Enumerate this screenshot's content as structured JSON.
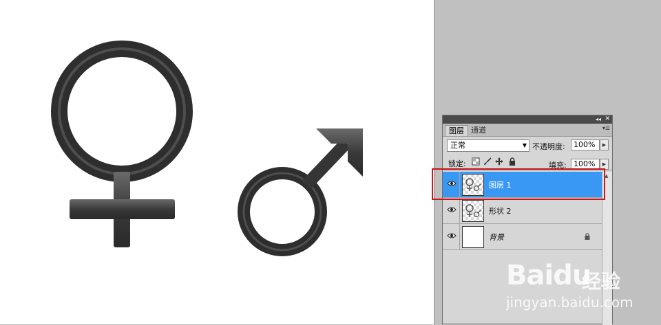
{
  "layers_panel": {
    "tab_layers": "图层",
    "tab_channels": "通道",
    "blend_mode": "正常",
    "opacity_label": "不透明度:",
    "opacity_value": "100%",
    "lock_label": "锁定:",
    "fill_label": "填充:",
    "fill_value": "100%",
    "layers": [
      {
        "name": "图层 1",
        "selected": true
      },
      {
        "name": "形状 2",
        "selected": false
      },
      {
        "name": "背景",
        "selected": false,
        "locked": true
      }
    ]
  },
  "watermark": {
    "logo": "Baidu",
    "brand_cn": "经验",
    "url": "jingyan.baidu.com"
  },
  "colors": {
    "selection": "#3a98f5",
    "highlight_box": "#c8171d",
    "canvas_bg": "#ffffff",
    "workspace_bg": "#c0c0c0",
    "symbol_fill": "#3c3c3c"
  },
  "icons": {
    "symbols": [
      "female-symbol-icon",
      "male-symbol-icon"
    ],
    "panel": [
      "eye-icon",
      "lock-icon",
      "move-icon",
      "brush-icon",
      "transparency-lock-icon"
    ]
  }
}
